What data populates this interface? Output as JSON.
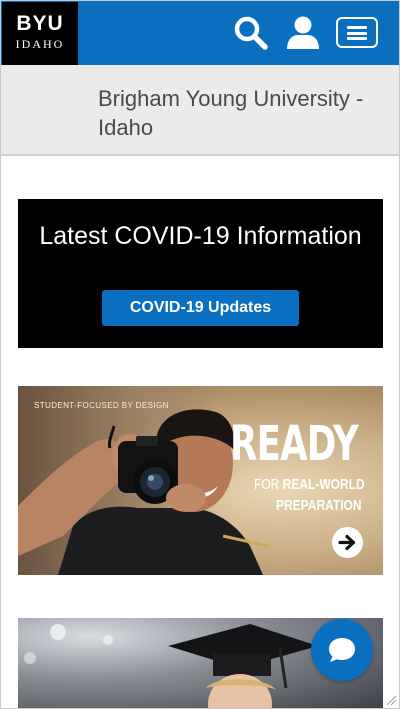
{
  "header": {
    "logo_line1": "BYU",
    "logo_line2": "IDAHO",
    "search_icon": "search-icon",
    "user_icon": "user-icon",
    "menu_icon": "hamburger-menu-icon",
    "brand_color": "#0a6fbf"
  },
  "title_band": {
    "title": "Brigham Young University - Idaho"
  },
  "covid": {
    "heading": "Latest COVID-19 Information",
    "button_label": "COVID-19 Updates"
  },
  "ready_banner": {
    "tag": "STUDENT-FOCUSED BY DESIGN",
    "headline": "READY",
    "sub_light": "FOR ",
    "sub_bold": "REAL-WORLD",
    "sub_line2": "PREPARATION",
    "arrow_icon": "arrow-right-icon"
  },
  "graduation_banner": {
    "image": "graduate-photo"
  },
  "chat": {
    "icon": "chat-bubble-icon"
  }
}
